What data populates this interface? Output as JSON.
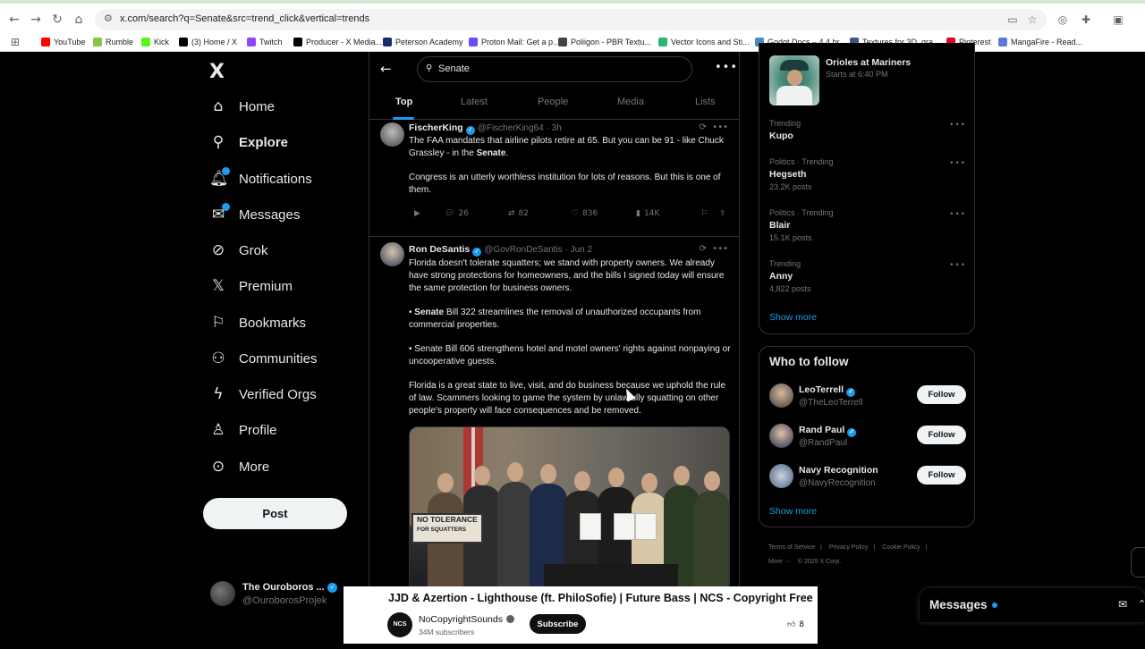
{
  "browser": {
    "url": "x.com/search?q=Senate&src=trend_click&vertical=trends",
    "bookmarks": [
      {
        "label": "YouTube",
        "color": "#ff0000"
      },
      {
        "label": "Rumble",
        "color": "#85c742"
      },
      {
        "label": "Kick",
        "color": "#53fc18"
      },
      {
        "label": "(3) Home / X",
        "color": "#000000"
      },
      {
        "label": "Twitch",
        "color": "#9146ff"
      },
      {
        "label": "Producer - X Media...",
        "color": "#000000"
      },
      {
        "label": "Peterson Academy",
        "color": "#1a2a6c"
      },
      {
        "label": "Proton Mail: Get a p...",
        "color": "#6d4aff"
      },
      {
        "label": "Poliigon - PBR Textu...",
        "color": "#444444"
      },
      {
        "label": "Vector Icons and Sti...",
        "color": "#2bb673"
      },
      {
        "label": "Godot Docs – 4.4 br...",
        "color": "#478cbf"
      },
      {
        "label": "Textures for 3D, gra...",
        "color": "#3d5a80"
      },
      {
        "label": "Pinterest",
        "color": "#e60023"
      },
      {
        "label": "MangaFire - Read...",
        "color": "#5b7bd5"
      }
    ]
  },
  "sidebar": {
    "logo": "X",
    "items": [
      {
        "label": "Home",
        "icon": "home-icon",
        "glyph": "⌂"
      },
      {
        "label": "Explore",
        "icon": "search-icon",
        "glyph": "⚲"
      },
      {
        "label": "Notifications",
        "icon": "bell-icon",
        "glyph": "🔔︎"
      },
      {
        "label": "Messages",
        "icon": "envelope-icon",
        "glyph": "✉"
      },
      {
        "label": "Grok",
        "icon": "grok-icon",
        "glyph": "⊘"
      },
      {
        "label": "Premium",
        "icon": "x-icon",
        "glyph": "𝕏"
      },
      {
        "label": "Bookmarks",
        "icon": "bookmark-icon",
        "glyph": "⚐"
      },
      {
        "label": "Communities",
        "icon": "people-icon",
        "glyph": "⚇"
      },
      {
        "label": "Verified Orgs",
        "icon": "lightning-icon",
        "glyph": "ϟ"
      },
      {
        "label": "Profile",
        "icon": "person-icon",
        "glyph": "♙"
      },
      {
        "label": "More",
        "icon": "more-circle-icon",
        "glyph": "⊙"
      }
    ],
    "post_label": "Post",
    "account": {
      "name": "The Ouroboros ...",
      "handle": "@OuroborosProjek"
    }
  },
  "search": {
    "query": "Senate",
    "tabs": [
      "Top",
      "Latest",
      "People",
      "Media",
      "Lists"
    ],
    "active_tab": "Top"
  },
  "tweets": [
    {
      "name": "FischerKing",
      "handle": "@FischerKing64",
      "time": "3h",
      "paragraphs": [
        "The FAA mandates that airline pilots retire at 65. But you can be 91 - like Chuck Grassley - in the <b>Senate</b>.",
        "Congress is an utterly worthless institution for lots of reasons. But this is one of them."
      ],
      "replies": "26",
      "reposts": "82",
      "likes": "836",
      "views": "14K"
    },
    {
      "name": "Ron DeSantis",
      "handle": "@GovRonDeSantis",
      "time": "Jun 2",
      "paragraphs": [
        "Florida doesn't tolerate squatters; we stand with property owners. We already have strong protections for homeowners, and the bills I signed today will ensure the same protection for business owners.",
        "• <b>Senate</b> Bill 322 streamlines the removal of unauthorized occupants from commercial properties.",
        "• Senate Bill 606 strengthens hotel and motel owners' rights against nonpaying or uncooperative guests.",
        "Florida is a great state to live, visit, and do business because we uphold the rule of law. Scammers looking to game the system by unlawfully squatting on other people's property will face consequences and be removed."
      ],
      "image_sign_line1": "NO TOLERANCE",
      "image_sign_line2": "FOR SQUATTERS"
    }
  ],
  "event": {
    "title": "Orioles at Mariners",
    "subtitle": "Starts at 6:40 PM"
  },
  "trends": [
    {
      "context": "Trending",
      "topic": "Kupo",
      "posts": ""
    },
    {
      "context": "Politics · Trending",
      "topic": "Hegseth",
      "posts": "23.2K posts"
    },
    {
      "context": "Politics · Trending",
      "topic": "Blair",
      "posts": "15.1K posts"
    },
    {
      "context": "Trending",
      "topic": "Anny",
      "posts": "4,822 posts"
    }
  ],
  "show_more": "Show more",
  "who_to_follow": {
    "title": "Who to follow",
    "accounts": [
      {
        "name": "LeoTerrell",
        "handle": "@TheLeoTerrell",
        "verified": true
      },
      {
        "name": "Rand Paul",
        "handle": "@RandPaul",
        "verified": true
      },
      {
        "name": "Navy Recognition",
        "handle": "@NavyRecognition",
        "verified": false
      }
    ],
    "follow_label": "Follow",
    "show_more": "Show more"
  },
  "footer": {
    "links": [
      "Terms of Service",
      "|",
      "Privacy Policy",
      "|",
      "Cookie Policy",
      "|"
    ],
    "more": "More ···",
    "copyright": "© 2025 X Corp."
  },
  "messages_dock": {
    "title": "Messages"
  },
  "youtube": {
    "title": "JJD & Azertion - Lighthouse (ft. PhiloSofie) | Future Bass | NCS - Copyright Free",
    "channel": "NoCopyrightSounds",
    "channel_avatar": "NCS",
    "subscribers": "34M subscribers",
    "subscribe_label": "Subscribe",
    "likes": "8"
  }
}
